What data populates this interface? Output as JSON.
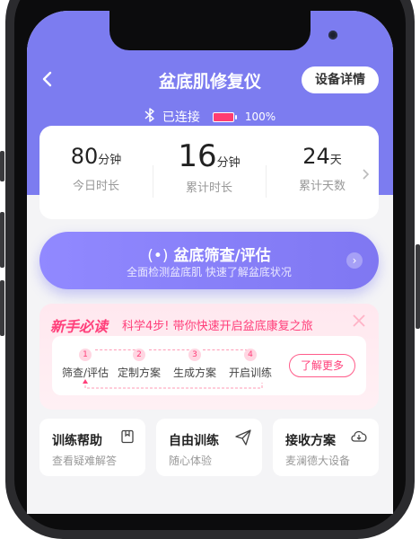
{
  "header": {
    "title": "盆底肌修复仪",
    "device_button": "设备详情",
    "connection_status": "已连接",
    "battery": "100%"
  },
  "stats": [
    {
      "value": "80",
      "unit": "分钟",
      "label": "今日时长"
    },
    {
      "value": "16",
      "unit": "分钟",
      "label": "累计时长"
    },
    {
      "value": "24",
      "unit": "天",
      "label": "累计天数"
    }
  ],
  "screening": {
    "title": "盆底筛查/评估",
    "subtitle": "全面检测盆底肌 快速了解盆底状况"
  },
  "newbie": {
    "badge": "新手必读",
    "hint": "科学4步! 带你快速开启盆底康复之旅",
    "more_button": "了解更多",
    "steps": [
      {
        "num": "1",
        "name": "筛查/评估"
      },
      {
        "num": "2",
        "name": "定制方案"
      },
      {
        "num": "3",
        "name": "生成方案"
      },
      {
        "num": "4",
        "name": "开启训练"
      }
    ]
  },
  "shortcuts": [
    {
      "title": "训练帮助",
      "sub": "查看疑难解答",
      "icon": "bookmark-icon"
    },
    {
      "title": "自由训练",
      "sub": "随心体验",
      "icon": "paper-plane-icon"
    },
    {
      "title": "接收方案",
      "sub": "麦澜德大设备",
      "icon": "cloud-download-icon"
    }
  ],
  "colors": {
    "accent": "#7c7cf0",
    "pink": "#ff3f7a"
  }
}
